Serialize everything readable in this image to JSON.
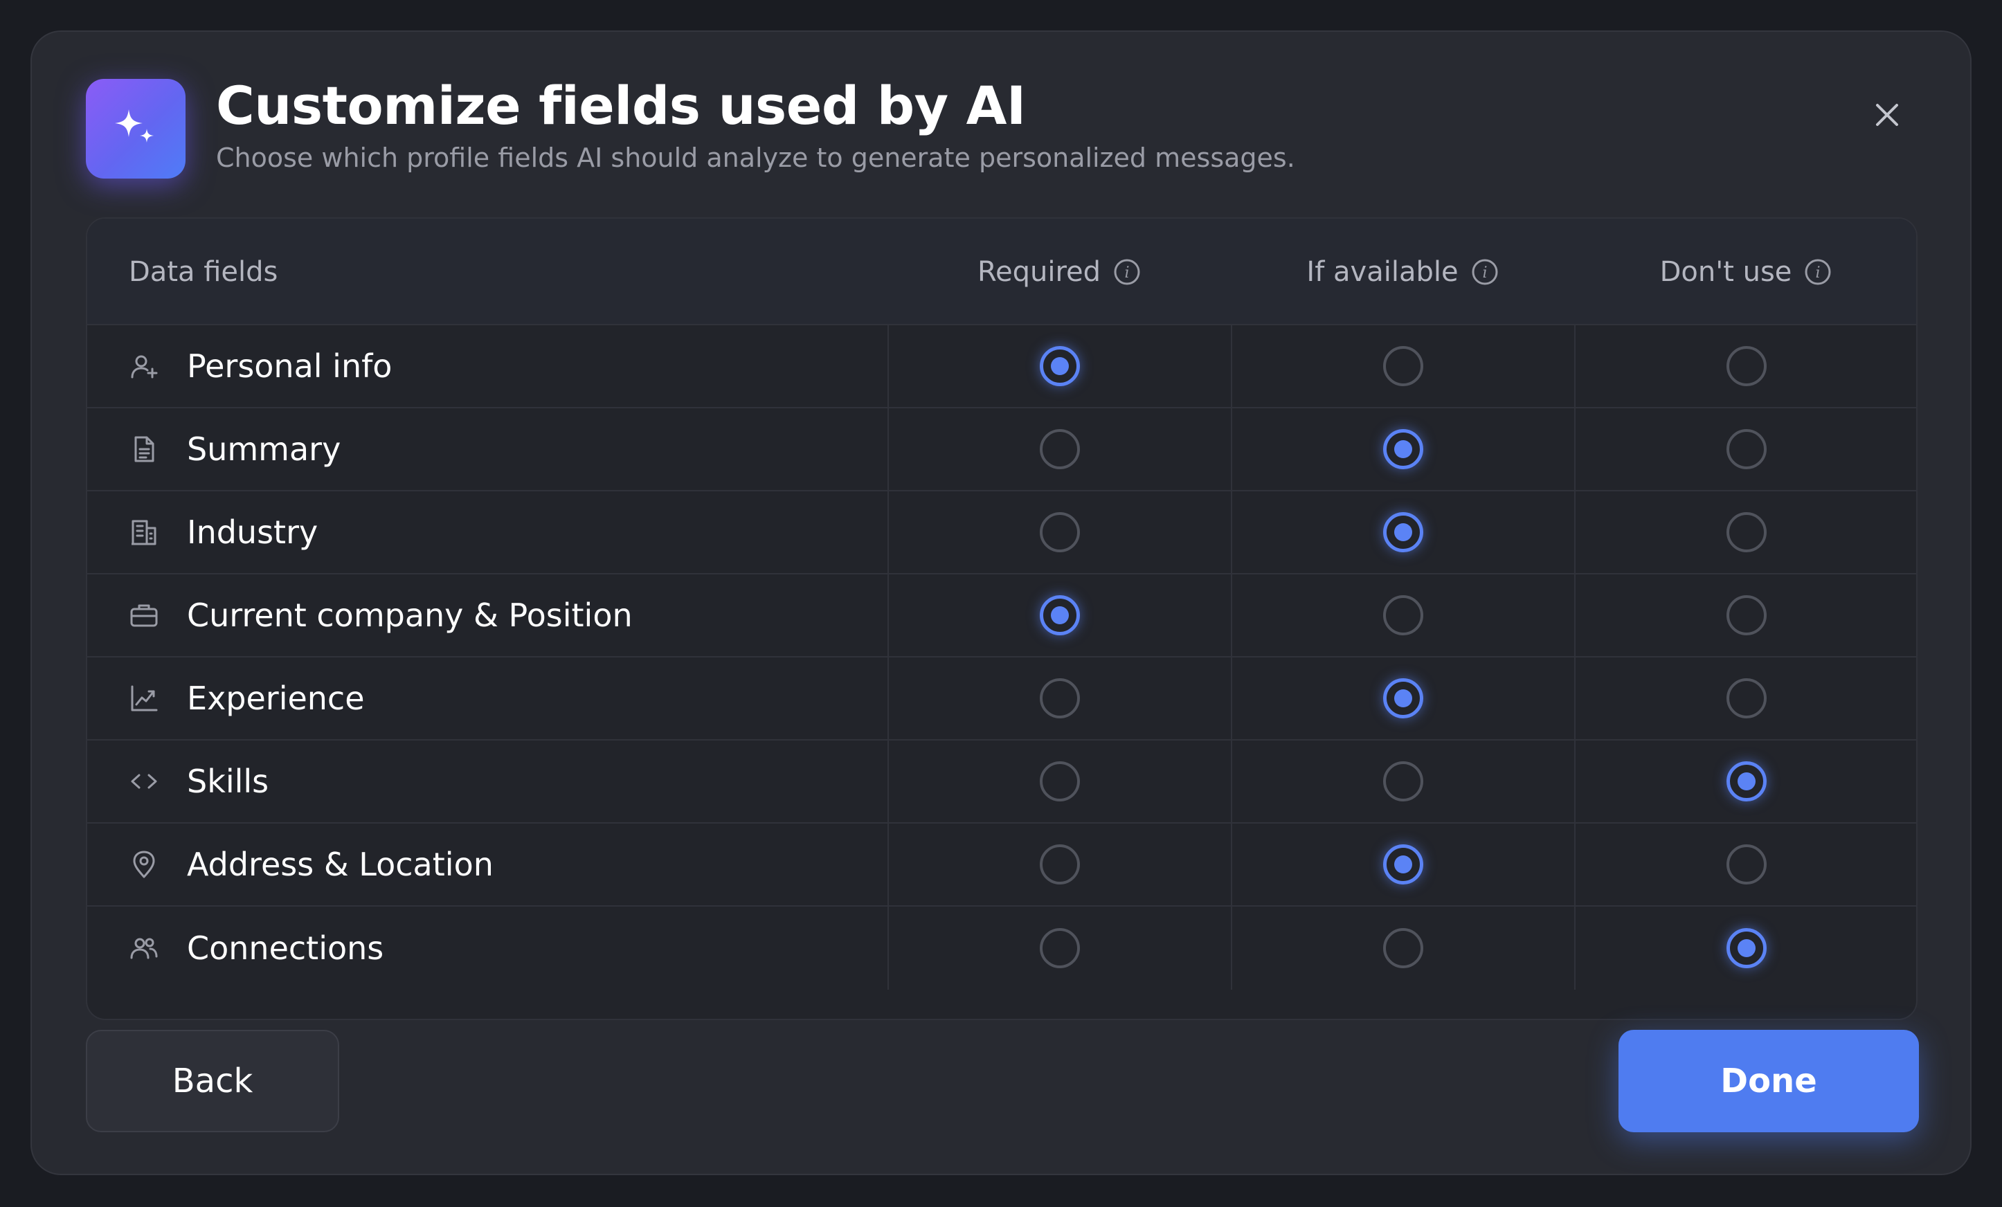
{
  "dialog": {
    "title": "Customize fields used by AI",
    "subtitle": "Choose which profile fields AI should analyze to generate personalized messages.",
    "header_icon": "sparkles-icon",
    "close_icon": "close-icon"
  },
  "table": {
    "headers": {
      "field": "Data fields",
      "required": "Required",
      "if_available": "If available",
      "dont_use": "Don't use"
    },
    "rows": [
      {
        "label": "Personal info",
        "icon": "user-plus-icon",
        "selected": "required"
      },
      {
        "label": "Summary",
        "icon": "document-icon",
        "selected": "if_available"
      },
      {
        "label": "Industry",
        "icon": "building-icon",
        "selected": "if_available"
      },
      {
        "label": "Current company & Position",
        "icon": "briefcase-icon",
        "selected": "required"
      },
      {
        "label": "Experience",
        "icon": "chart-line-icon",
        "selected": "if_available"
      },
      {
        "label": "Skills",
        "icon": "code-icon",
        "selected": "dont_use"
      },
      {
        "label": "Address & Location",
        "icon": "map-pin-icon",
        "selected": "if_available"
      },
      {
        "label": "Connections",
        "icon": "users-icon",
        "selected": "dont_use"
      }
    ]
  },
  "footer": {
    "back_label": "Back",
    "done_label": "Done"
  },
  "colors": {
    "accent": "#4f7cf0",
    "radio_checked": "#5b83f5",
    "background": "#282a31"
  }
}
